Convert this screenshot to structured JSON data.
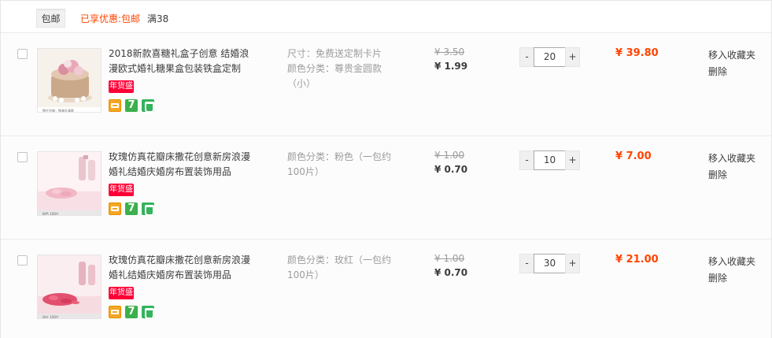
{
  "promo": {
    "tag_label": "包邮",
    "enjoyed_label": "已享优惠:",
    "enjoyed_value": "包邮",
    "threshold": "满38"
  },
  "items": [
    {
      "title": "2018新款喜糖礼盒子创意 结婚浪漫欧式婚礼糖果盒包装铁盒定制",
      "badge": "年货盛典",
      "sku_line1": "尺寸：免费送定制卡片",
      "sku_line2": "颜色分类：尊贵金圆款（小）",
      "price_old": "¥ 3.50",
      "price_new": "¥ 1.99",
      "qty_minus": "-",
      "qty": "20",
      "qty_plus": "+",
      "subtotal": "¥ 39.80",
      "fav": "移入收藏夹",
      "del": "删除",
      "svc_seven": "7",
      "img_caption": "图片包装：铁盒礼盒款"
    },
    {
      "title": "玫瑰仿真花瓣床撒花创意新房浪漫婚礼结婚庆婚房布置装饰用品",
      "badge": "年货盛典",
      "sku_line1": "颜色分类：粉色（一包约100片）",
      "sku_line2": "",
      "price_old": "¥ 1.00",
      "price_new": "¥ 0.70",
      "qty_minus": "-",
      "qty": "10",
      "qty_plus": "+",
      "subtotal": "¥ 7.00",
      "fav": "移入收藏夹",
      "del": "删除",
      "svc_seven": "7",
      "img_caption": "粉色 100片"
    },
    {
      "title": "玫瑰仿真花瓣床撒花创意新房浪漫婚礼结婚庆婚房布置装饰用品",
      "badge": "年货盛典",
      "sku_line1": "颜色分类：玫红（一包约100片）",
      "sku_line2": "",
      "price_old": "¥ 1.00",
      "price_new": "¥ 0.70",
      "qty_minus": "-",
      "qty": "30",
      "qty_plus": "+",
      "subtotal": "¥ 21.00",
      "fav": "移入收藏夹",
      "del": "删除",
      "svc_seven": "7",
      "img_caption": "玫红 100片"
    }
  ],
  "colors": {
    "accent": "#ff4400",
    "badge": "#ff0036",
    "service_green": "#3bb04b",
    "service_orange": "#f5a623"
  },
  "icons": [
    "checkbox-icon",
    "card-payment-icon",
    "seven-day-return-icon",
    "guarantee-icon"
  ]
}
